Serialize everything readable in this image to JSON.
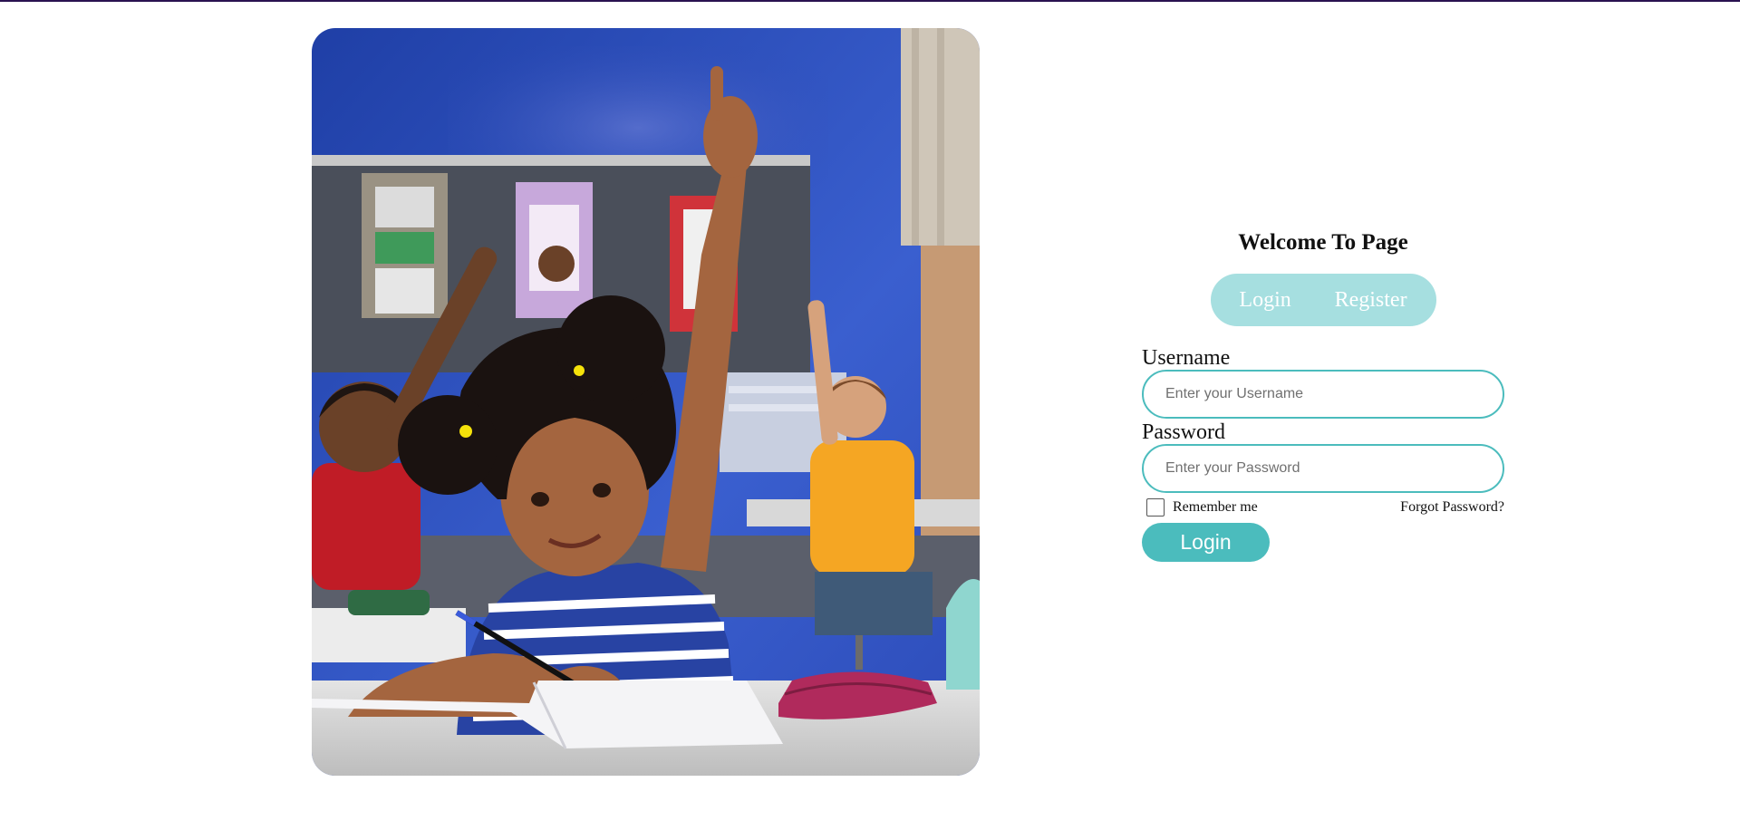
{
  "colors": {
    "top_bar": "#2a1250",
    "tab_background": "#a6dfe0",
    "accent": "#4bbcbd"
  },
  "hero_image": {
    "icon": "classroom-photo"
  },
  "panel": {
    "welcome_title": "Welcome To Page",
    "tabs": [
      {
        "label": "Login"
      },
      {
        "label": "Register"
      }
    ],
    "username": {
      "label": "Username",
      "placeholder": "Enter your Username",
      "value": ""
    },
    "password": {
      "label": "Password",
      "placeholder": "Enter your Password",
      "value": ""
    },
    "remember_label": "Remember me",
    "remember_checked": false,
    "forgot_label": "Forgot Password?",
    "login_button": "Login"
  }
}
